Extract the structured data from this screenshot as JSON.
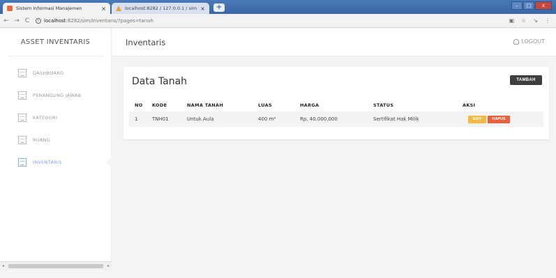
{
  "browser": {
    "tabs": [
      {
        "title": "Sistem Informasi Manajemen",
        "close": "×"
      },
      {
        "title": "localhost:8282 / 127.0.0.1 / sim /",
        "close": "×"
      }
    ],
    "new_tab": "+",
    "url_host": "localhost",
    "url_path": ":8282/sim/Inventaris/?pages=tanah",
    "window_controls": [
      "–",
      "□",
      "x"
    ]
  },
  "sidebar": {
    "brand": "ASSET INVENTARIS",
    "items": [
      {
        "label": "DASHBOARD",
        "icon": "dashboard-icon"
      },
      {
        "label": "PENANGUNG JAWAB",
        "icon": "user-card-icon"
      },
      {
        "label": "KATEGORI",
        "icon": "list-icon"
      },
      {
        "label": "RUANG",
        "icon": "room-icon"
      },
      {
        "label": "INVENTARIS",
        "icon": "inventory-icon",
        "active": true
      }
    ]
  },
  "header": {
    "title": "Inventaris",
    "logout_label": "LOGOUT"
  },
  "card": {
    "title": "Data Tanah",
    "add_label": "TAMBAH",
    "columns": [
      "NO",
      "KODE",
      "NAMA TANAH",
      "LUAS",
      "HARGA",
      "STATUS",
      "AKSI"
    ],
    "rows": [
      {
        "no": "1",
        "kode": "TNH01",
        "nama": "Untuk Aula",
        "luas": "400 m²",
        "harga": "Rp. 40.000.000",
        "status": "Sertifikat Hak Milik"
      }
    ],
    "edit_label": "EDIT",
    "delete_label": "HAPUS"
  },
  "colors": {
    "tab_bar": "#3a67a6",
    "edit_button": "#f5b942",
    "delete_button": "#e8603c",
    "add_button": "#3f3f3f",
    "active_menu": "#7fa6d6"
  }
}
